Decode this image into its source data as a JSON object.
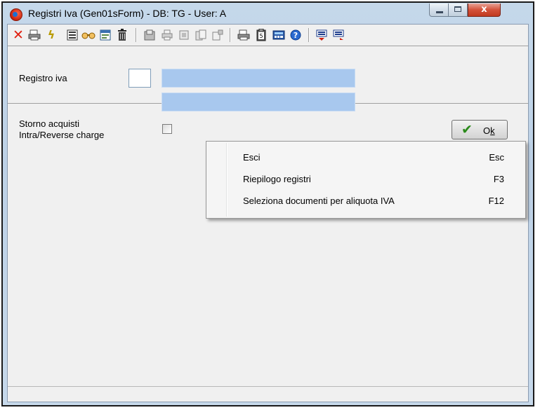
{
  "window": {
    "title": "Registri Iva  (Gen01sForm) - DB: TG - User: A",
    "close_glyph": "x"
  },
  "toolbar": {
    "icons": [
      "close-red-x-icon",
      "print-icon",
      "lightning-icon",
      "list-icon",
      "glasses-icon",
      "window-icon",
      "trash-icon",
      "import-icon",
      "printer-icon",
      "document-icon",
      "copy-icon",
      "export-icon",
      "print-preview-icon",
      "clipboard-icon",
      "calculator-icon",
      "help-icon",
      "move-up-icon",
      "move-down-icon"
    ]
  },
  "form": {
    "registro_label": "Registro iva",
    "registro_code": "",
    "registro_desc1": "",
    "registro_desc2": "",
    "storno_label_line1": "Storno acquisti",
    "storno_label_line2": "Intra/Reverse charge",
    "storno_checked": false
  },
  "ok_button": {
    "label_prefix": "O",
    "label_underlined": "k",
    "check_glyph": "✔"
  },
  "context_menu": {
    "items": [
      {
        "label": "Esci",
        "shortcut": "Esc"
      },
      {
        "label": "Riepilogo registri",
        "shortcut": "F3"
      },
      {
        "label": "Seleziona documenti per aliquota IVA",
        "shortcut": "F12"
      }
    ]
  },
  "status": {
    "text": ""
  },
  "colors": {
    "accent_field": "#a8c8ee",
    "ok_check": "#2a8a1a",
    "close_button": "#c03a20"
  }
}
